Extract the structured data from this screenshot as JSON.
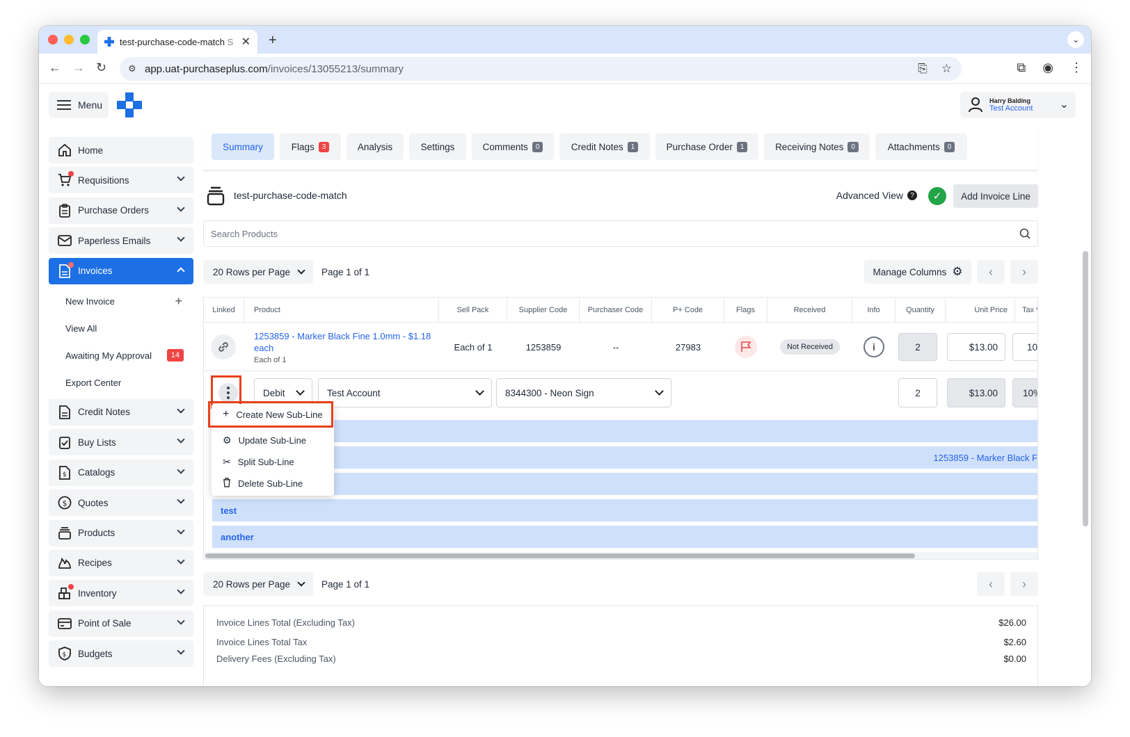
{
  "browser": {
    "tab_title": "test-purchase-code-match",
    "tab_title_suffix": "S",
    "url_host": "app.uat-purchaseplus.com",
    "url_path": "/invoices/13055213/summary"
  },
  "header": {
    "menu_label": "Menu",
    "user_name": "Harry Balding",
    "user_account": "Test Account"
  },
  "sidebar": {
    "items": [
      {
        "label": "Home",
        "icon": "home-icon"
      },
      {
        "label": "Requisitions",
        "icon": "cart-icon"
      },
      {
        "label": "Purchase Orders",
        "icon": "clipboard-icon"
      },
      {
        "label": "Paperless Emails",
        "icon": "mail-icon"
      },
      {
        "label": "Invoices",
        "icon": "document-icon"
      }
    ],
    "sub_items": [
      {
        "label": "New Invoice"
      },
      {
        "label": "View All"
      },
      {
        "label": "Awaiting My Approval",
        "badge": "14"
      },
      {
        "label": "Export Center"
      }
    ],
    "lower_items": [
      {
        "label": "Credit Notes"
      },
      {
        "label": "Buy Lists"
      },
      {
        "label": "Catalogs"
      },
      {
        "label": "Quotes"
      },
      {
        "label": "Products"
      },
      {
        "label": "Recipes"
      },
      {
        "label": "Inventory"
      },
      {
        "label": "Point of Sale"
      },
      {
        "label": "Budgets"
      }
    ]
  },
  "tabs": [
    {
      "label": "Summary"
    },
    {
      "label": "Flags",
      "badge": "3"
    },
    {
      "label": "Analysis"
    },
    {
      "label": "Settings"
    },
    {
      "label": "Comments",
      "badge": "0"
    },
    {
      "label": "Credit Notes",
      "badge": "1"
    },
    {
      "label": "Purchase Order",
      "badge": "1"
    },
    {
      "label": "Receiving Notes",
      "badge": "0"
    },
    {
      "label": "Attachments",
      "badge": "0"
    }
  ],
  "invoice": {
    "title": "test-purchase-code-match",
    "advanced_view": "Advanced View",
    "add_line": "Add Invoice Line",
    "search_placeholder": "Search Products"
  },
  "pager": {
    "rows_label": "20 Rows per Page",
    "page_text": "Page 1 of 1",
    "manage_columns": "Manage Columns"
  },
  "table": {
    "headers": [
      "Linked",
      "Product",
      "Sell Pack",
      "Supplier Code",
      "Purchaser Code",
      "P+ Code",
      "Flags",
      "Received",
      "Info",
      "Quantity",
      "Unit Price",
      "Tax %"
    ],
    "row": {
      "product": "1253859 - Marker Black Fine 1.0mm - $1.18 each",
      "product_sub": "Each of 1",
      "sell_pack": "Each of 1",
      "supplier_code": "1253859",
      "purchaser_code": "--",
      "p_code": "27983",
      "received": "Not Received",
      "quantity": "2",
      "unit_price": "$13.00",
      "tax": "10"
    },
    "subline": {
      "type": "Debit",
      "account": "Test Account",
      "code": "8344300 - Neon Sign",
      "quantity": "2",
      "unit_price": "$13.00",
      "tax": "10%"
    },
    "bands": [
      {
        "label": ""
      },
      {
        "label": "",
        "link": "1253859 - Marker Black F"
      },
      {
        "label": ""
      },
      {
        "label": "test"
      },
      {
        "label": "another"
      }
    ]
  },
  "context_menu": {
    "items": [
      {
        "label": "Create New Sub-Line",
        "icon": "plus-icon"
      },
      {
        "label": "Update Sub-Line",
        "icon": "gear-icon"
      },
      {
        "label": "Split Sub-Line",
        "icon": "scissors-icon"
      },
      {
        "label": "Delete Sub-Line",
        "icon": "trash-icon"
      }
    ]
  },
  "totals": [
    {
      "label": "Invoice Lines Total (Excluding Tax)",
      "value": "$26.00"
    },
    {
      "label": "Invoice Lines Total Tax",
      "value": "$2.60"
    },
    {
      "label": "Delivery Fees (Excluding Tax)",
      "value": "$0.00"
    }
  ],
  "colors": {
    "accent": "#1d6fe4",
    "danger": "#ef4444",
    "highlight": "#e8401c"
  }
}
